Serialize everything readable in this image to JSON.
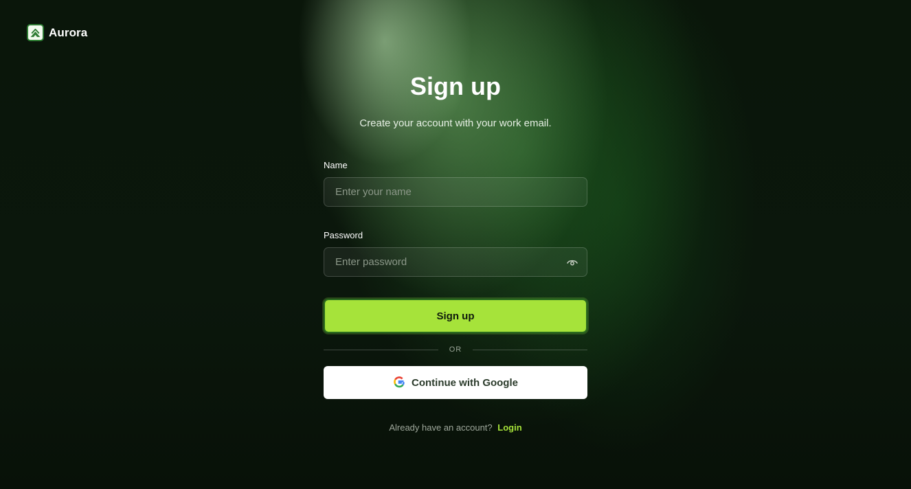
{
  "brand": {
    "name": "Aurora"
  },
  "form": {
    "title": "Sign up",
    "subtitle": "Create your account with your work email.",
    "name_label": "Name",
    "name_placeholder": "Enter your name",
    "password_label": "Password",
    "password_placeholder": "Enter password",
    "submit_label": "Sign up",
    "divider_label": "OR",
    "google_label": "Continue with Google",
    "footer_text": "Already have an account?",
    "login_label": "Login"
  },
  "icons": {
    "brand": "aurora-logo-icon",
    "password_toggle": "eye-icon",
    "google": "google-icon"
  },
  "colors": {
    "accent": "#a6e33a",
    "background": "#081308"
  }
}
